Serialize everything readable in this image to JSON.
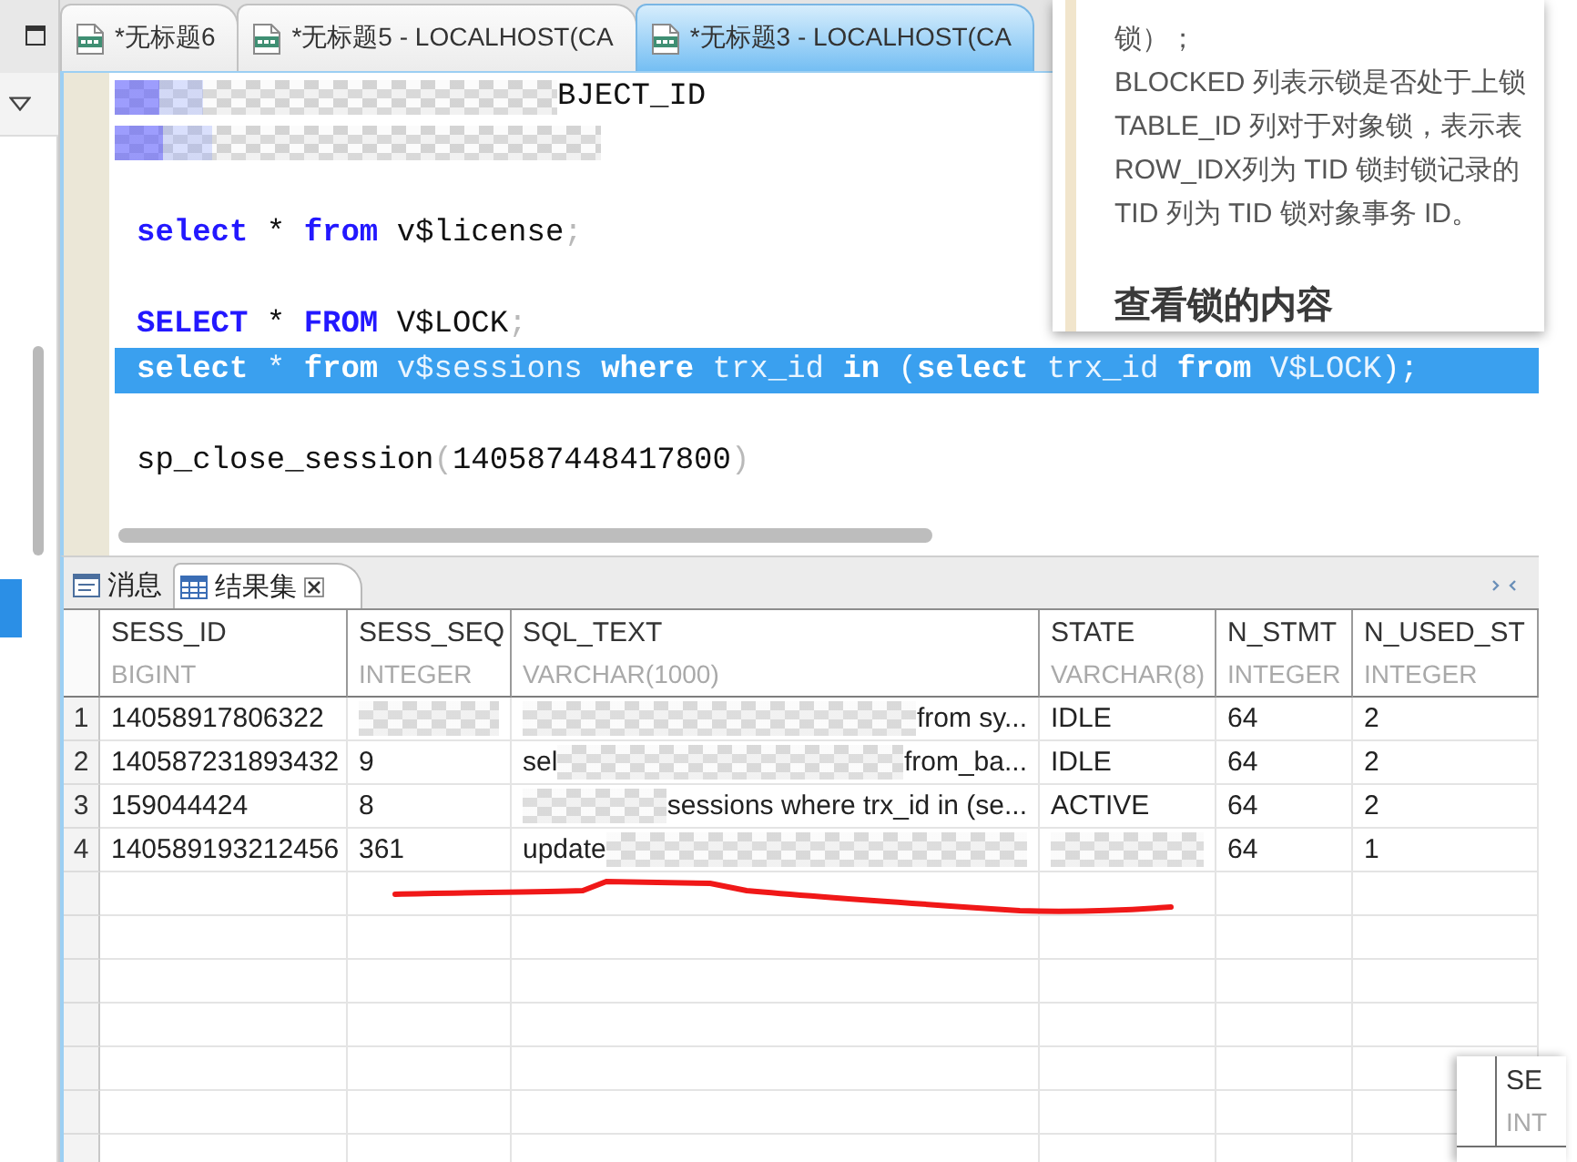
{
  "editor_tabs": [
    {
      "label": "*无标题6",
      "selected": false
    },
    {
      "label": "*无标题5 - LOCALHOST(CA",
      "selected": false
    },
    {
      "label": "*无标题3 - LOCALHOST(CA",
      "selected": true
    }
  ],
  "editor": {
    "lines": [
      {
        "kind": "redacted",
        "selected": false,
        "tail": "BJECT_ID"
      },
      {
        "kind": "redacted",
        "selected": false
      },
      {
        "kind": "blank",
        "selected": false
      },
      {
        "kind": "code",
        "selected": false,
        "tokens": [
          {
            "kind": "keyword",
            "text": "select"
          },
          {
            "kind": "plain",
            "text": " * "
          },
          {
            "kind": "keyword",
            "text": "from"
          },
          {
            "kind": "plain",
            "text": " v$license"
          },
          {
            "kind": "punct",
            "text": ";"
          }
        ]
      },
      {
        "kind": "blank",
        "selected": false
      },
      {
        "kind": "code",
        "selected": false,
        "tokens": [
          {
            "kind": "keyword",
            "text": "SELECT"
          },
          {
            "kind": "plain",
            "text": " * "
          },
          {
            "kind": "keyword",
            "text": "FROM"
          },
          {
            "kind": "plain",
            "text": " V$LOCK"
          },
          {
            "kind": "punct",
            "text": ";"
          }
        ]
      },
      {
        "kind": "code",
        "selected": true,
        "tokens": [
          {
            "kind": "keyword",
            "text": "select"
          },
          {
            "kind": "plain",
            "text": " * "
          },
          {
            "kind": "keyword",
            "text": "from"
          },
          {
            "kind": "plain",
            "text": " v$sessions "
          },
          {
            "kind": "keyword",
            "text": "where"
          },
          {
            "kind": "plain",
            "text": " trx_id "
          },
          {
            "kind": "keyword",
            "text": "in"
          },
          {
            "kind": "punct",
            "text": " ("
          },
          {
            "kind": "keyword",
            "text": "select"
          },
          {
            "kind": "plain",
            "text": " trx_id "
          },
          {
            "kind": "keyword",
            "text": "from"
          },
          {
            "kind": "plain",
            "text": " V$LOCK"
          },
          {
            "kind": "punct",
            "text": ");"
          }
        ]
      },
      {
        "kind": "blank",
        "selected": false
      },
      {
        "kind": "code",
        "selected": false,
        "tokens": [
          {
            "kind": "plain",
            "text": "sp_close_session"
          },
          {
            "kind": "punct",
            "text": "("
          },
          {
            "kind": "plain",
            "text": "140587448417800"
          },
          {
            "kind": "punct",
            "text": ")"
          }
        ]
      }
    ]
  },
  "doc_excerpt": {
    "lines": [
      "锁）；",
      "BLOCKED 列表示锁是否处于上锁",
      "TABLE_ID 列对于对象锁，表示表",
      "ROW_IDX列为 TID 锁封锁记录的",
      "TID 列为 TID 锁对象事务 ID。"
    ],
    "heading": "查看锁的内容"
  },
  "result_tabs": [
    {
      "kind": "messages",
      "label": "消息",
      "selected": false,
      "closable": false
    },
    {
      "kind": "grid",
      "label": "结果集",
      "selected": true,
      "closable": true
    }
  ],
  "result_grid": {
    "columns": [
      {
        "name": "SESS_ID",
        "type": "BIGINT"
      },
      {
        "name": "SESS_SEQ",
        "type": "INTEGER"
      },
      {
        "name": "SQL_TEXT",
        "type": "VARCHAR(1000)"
      },
      {
        "name": "STATE",
        "type": "VARCHAR(8)"
      },
      {
        "name": "N_STMT",
        "type": "INTEGER"
      },
      {
        "name": "N_USED_ST",
        "type": "INTEGER"
      }
    ],
    "rows": [
      {
        "number": "1",
        "cells": [
          "14058917806322",
          {
            "segments": [
              {
                "kind": "blur"
              }
            ]
          },
          {
            "segments": [
              {
                "kind": "blur"
              },
              {
                "kind": "text",
                "text": "from sy..."
              }
            ]
          },
          "IDLE",
          "64",
          "2"
        ]
      },
      {
        "number": "2",
        "cells": [
          "140587231893432",
          "9",
          {
            "segments": [
              {
                "kind": "text",
                "text": "sel"
              },
              {
                "kind": "blur"
              },
              {
                "kind": "text",
                "text": "from_ba..."
              }
            ]
          },
          "IDLE",
          "64",
          "2"
        ]
      },
      {
        "number": "3",
        "cells": [
          "159044424",
          "8",
          {
            "segments": [
              {
                "kind": "blur"
              },
              {
                "kind": "text",
                "text": "sessions where trx_id in (se..."
              }
            ]
          },
          "ACTIVE",
          "64",
          "2"
        ]
      },
      {
        "number": "4",
        "cells": [
          "140589193212456",
          "361",
          {
            "segments": [
              {
                "kind": "text",
                "text": "update"
              },
              {
                "kind": "blur"
              }
            ]
          },
          {
            "segments": [
              {
                "kind": "blur"
              }
            ]
          },
          "64",
          "1"
        ]
      }
    ]
  },
  "grid_fragment": {
    "column": "SE",
    "type": "INT"
  }
}
